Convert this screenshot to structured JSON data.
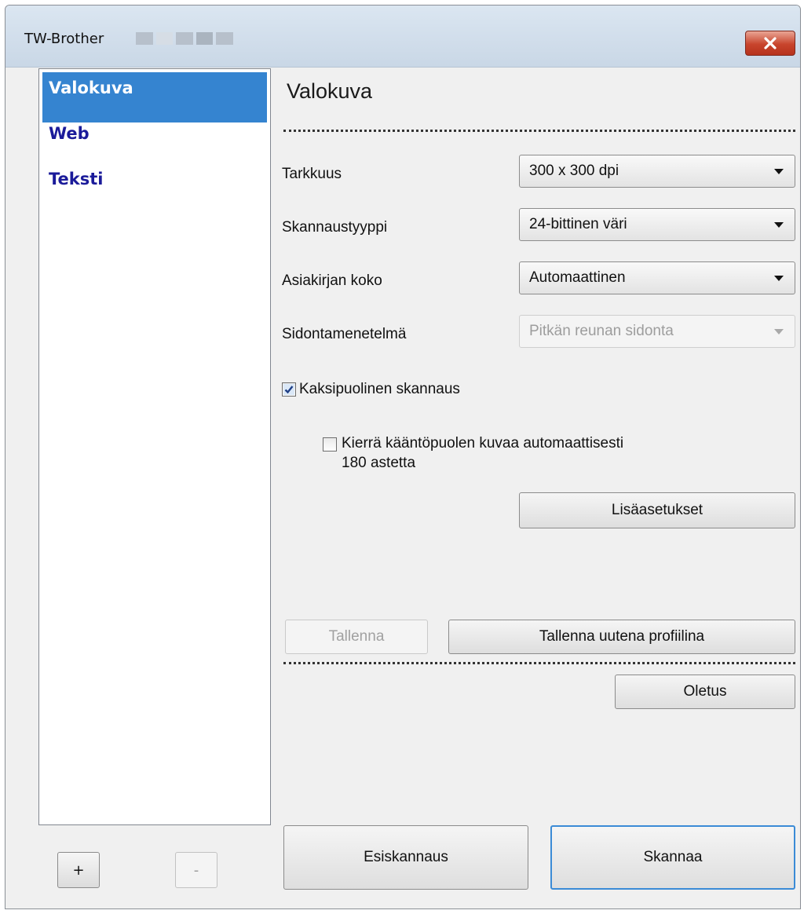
{
  "window": {
    "title": "TW-Brother",
    "close_icon": "close-icon"
  },
  "profiles": {
    "items": [
      {
        "label": "Valokuva",
        "selected": true
      },
      {
        "label": "Web",
        "selected": false
      },
      {
        "label": "Teksti",
        "selected": false
      }
    ],
    "add_label": "+",
    "remove_label": "-"
  },
  "settings": {
    "heading": "Valokuva",
    "resolution": {
      "label": "Tarkkuus",
      "value": "300 x 300 dpi"
    },
    "scan_type": {
      "label": "Skannaustyyppi",
      "value": "24-bittinen väri"
    },
    "document_size": {
      "label": "Asiakirjan koko",
      "value": "Automaattinen"
    },
    "binding": {
      "label": "Sidontamenetelmä",
      "value": "Pitkän reunan sidonta",
      "enabled": false
    },
    "duplex": {
      "label": "Kaksipuolinen skannaus",
      "checked": true
    },
    "rotate": {
      "label_line1": "Kierrä kääntöpuolen kuvaa automaattisesti",
      "label_line2": "180 astetta",
      "checked": false
    },
    "advanced_button": "Lisäasetukset",
    "default_button": "Oletus",
    "save_button": "Tallenna",
    "save_new_button": "Tallenna uutena profiilina"
  },
  "footer": {
    "prescan_button": "Esiskannaus",
    "scan_button": "Skannaa"
  },
  "colors": {
    "selected_bg": "#3584d0",
    "list_text": "#1b1b9a",
    "close_red": "#c8442c",
    "primary_border": "#3b8bd6"
  }
}
